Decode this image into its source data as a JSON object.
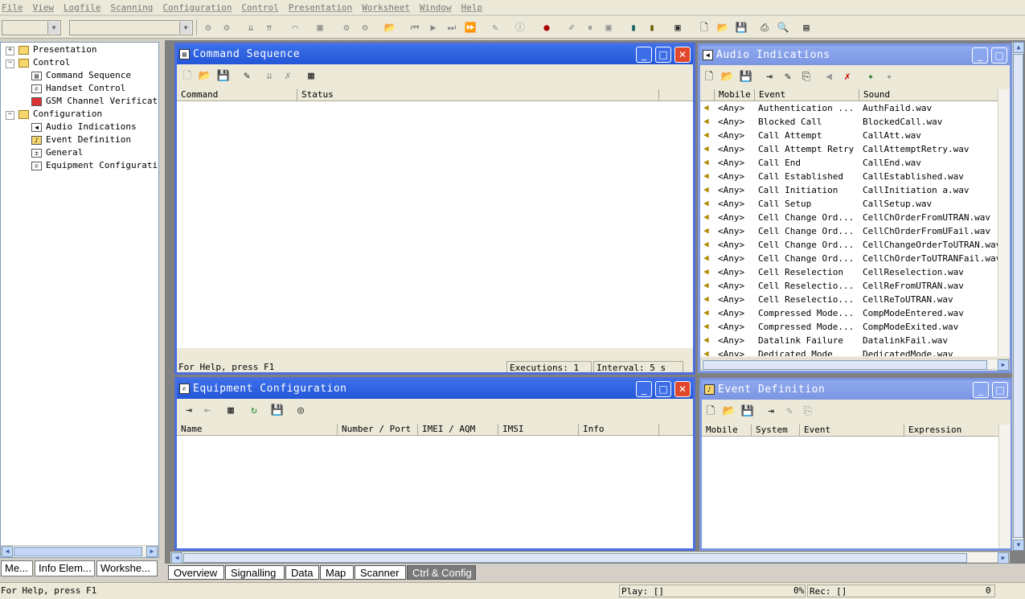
{
  "menu": [
    "File",
    "View",
    "Logfile",
    "Scanning",
    "Configuration",
    "Control",
    "Presentation",
    "Worksheet",
    "Window",
    "Help"
  ],
  "tree": {
    "presentation": "Presentation",
    "control": "Control",
    "control_items": [
      "Command Sequence",
      "Handset Control",
      "GSM Channel Verification"
    ],
    "configuration": "Configuration",
    "configuration_items": [
      "Audio Indications",
      "Event Definition",
      "General",
      "Equipment Configuration"
    ]
  },
  "left_tabs": [
    "Me...",
    "Info Elem...",
    "Workshe..."
  ],
  "command_sequence": {
    "title": "Command Sequence",
    "columns": [
      "Command",
      "Status"
    ],
    "help": "For Help, press F1",
    "executions": "Executions: 1",
    "interval": "Interval: 5 s"
  },
  "audio": {
    "title": "Audio Indications",
    "columns": [
      "Mobile",
      "Event",
      "Sound"
    ],
    "rows": [
      [
        "<Any>",
        "Authentication ...",
        "AuthFaild.wav"
      ],
      [
        "<Any>",
        "Blocked Call",
        "BlockedCall.wav"
      ],
      [
        "<Any>",
        "Call Attempt",
        "CallAtt.wav"
      ],
      [
        "<Any>",
        "Call Attempt Retry",
        "CallAttemptRetry.wav"
      ],
      [
        "<Any>",
        "Call End",
        "CallEnd.wav"
      ],
      [
        "<Any>",
        "Call Established",
        "CallEstablished.wav"
      ],
      [
        "<Any>",
        "Call Initiation",
        "CallInitiation a.wav"
      ],
      [
        "<Any>",
        "Call Setup",
        "CallSetup.wav"
      ],
      [
        "<Any>",
        "Cell Change Ord...",
        "CellChOrderFromUTRAN.wav"
      ],
      [
        "<Any>",
        "Cell Change Ord...",
        "CellChOrderFromUFail.wav"
      ],
      [
        "<Any>",
        "Cell Change Ord...",
        "CellChangeOrderToUTRAN.wav"
      ],
      [
        "<Any>",
        "Cell Change Ord...",
        "CellChOrderToUTRANFail.wav"
      ],
      [
        "<Any>",
        "Cell Reselection",
        "CellReselection.wav"
      ],
      [
        "<Any>",
        "Cell Reselectio...",
        "CellReFromUTRAN.wav"
      ],
      [
        "<Any>",
        "Cell Reselectio...",
        "CellReToUTRAN.wav"
      ],
      [
        "<Any>",
        "Compressed Mode...",
        "CompModeEntered.wav"
      ],
      [
        "<Any>",
        "Compressed Mode...",
        "CompModeExited.wav"
      ],
      [
        "<Any>",
        "Datalink Failure",
        "DatalinkFail.wav"
      ],
      [
        "<Any>",
        "Dedicated Mode",
        "DedicatedMode.wav"
      ]
    ]
  },
  "equipment": {
    "title": "Equipment Configuration",
    "columns": [
      "Name",
      "Number / Port",
      "IMEI / AQM",
      "IMSI",
      "Info"
    ]
  },
  "event_def": {
    "title": "Event Definition",
    "columns": [
      "Mobile",
      "System",
      "Event",
      "Expression"
    ]
  },
  "bottom_tabs": [
    "Overview",
    "Signalling",
    "Data",
    "Map",
    "Scanner",
    "Ctrl & Config"
  ],
  "status": {
    "help": "For Help, press F1",
    "play": "Play: []",
    "pct": "0%",
    "rec": "Rec: []",
    "count": "0"
  },
  "colors": {
    "title_active": "#2456d8",
    "title_inactive": "#7b96e2",
    "close": "#e0472b"
  }
}
